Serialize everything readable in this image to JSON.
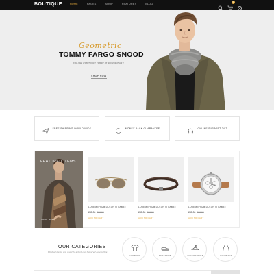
{
  "header": {
    "logo": "BOUTIQUE",
    "nav": [
      "HOME",
      "PAGES",
      "SHOP",
      "FEATURES",
      "BLOG"
    ],
    "active_nav": "HOME",
    "cart_count": "0",
    "accent": "#e4a93a"
  },
  "hero": {
    "script": "Geometric",
    "title": "TOMMY FARGO SNOOD",
    "subtitle": "We like difference range of accessories !",
    "button": "SHOP NOW"
  },
  "features": [
    {
      "icon": "paper-plane-icon",
      "label": "FREE SHIPPING WORLD WIDE"
    },
    {
      "icon": "money-back-icon",
      "label": "MONEY BACK GUARANTEE"
    },
    {
      "icon": "headset-icon",
      "label": "ONLINE SUPPORT 24/7"
    }
  ],
  "products": {
    "featured_label": "FEATURED ITEMS",
    "featured_link": "SHOP NOW",
    "items": [
      {
        "name": "LOREM IPSUM DOLOR SIT AMET",
        "price": "£80.00",
        "old_price": "£90.00",
        "action": "ADD TO CART"
      },
      {
        "name": "LOREM IPSUM DOLOR SIT AMET",
        "price": "£80.00",
        "old_price": "£90.00",
        "action": "ADD TO CART"
      },
      {
        "name": "LOREM IPSUM DOLOR SIT AMET",
        "price": "£80.00",
        "old_price": "£90.00",
        "action": "ADD TO CART"
      }
    ]
  },
  "categories": {
    "title": "OUR CATEGORIES",
    "subtitle": "Find all items you want to select our featured categories",
    "items": [
      {
        "icon": "tshirt-icon",
        "label": "CLOTHING"
      },
      {
        "icon": "sneaker-icon",
        "label": "SNEAKERS"
      },
      {
        "icon": "hanger-icon",
        "label": "ACCESSORIES"
      },
      {
        "icon": "handbag-icon",
        "label": "HANDBAGS"
      }
    ]
  }
}
